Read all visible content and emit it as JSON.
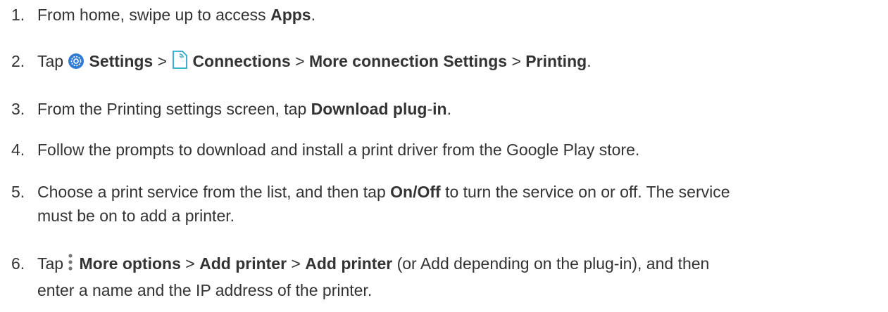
{
  "steps": [
    {
      "number": "1.",
      "parts": {
        "t1": "From home, swipe up to access ",
        "b1": "Apps",
        "t2": "."
      }
    },
    {
      "number": "2.",
      "parts": {
        "t1": "Tap ",
        "icon1": "settings-gear-icon",
        "b1": "Settings",
        "t2": " > ",
        "icon2": "connections-icon",
        "b2": "Connections",
        "t3": " > ",
        "b3": "More connection Settings",
        "t4": " > ",
        "b4": "Printing",
        "t5": "."
      }
    },
    {
      "number": "3.",
      "parts": {
        "t1": "From the Printing settings screen, tap ",
        "b1": "Download plug",
        "t2": "-",
        "b2": "in",
        "t3": "."
      }
    },
    {
      "number": "4.",
      "parts": {
        "t1": "Follow the prompts to download and install a print driver from the Google Play store."
      }
    },
    {
      "number": "5.",
      "parts": {
        "t1": "Choose a print service from the list, and then tap ",
        "b1": "On/Off",
        "t2": " to turn the service on or off. The service",
        "line2": "must be on to add a printer."
      }
    },
    {
      "number": "6.",
      "parts": {
        "t1": "Tap ",
        "icon1": "more-options-icon",
        "b1": "More options",
        "t2": " > ",
        "b2": "Add printer",
        "t3": " > ",
        "b3": "Add printer",
        "t4": " (or Add depending on the plug-in), and then",
        "line2": "enter a name and the IP address of the printer."
      }
    }
  ],
  "colors": {
    "text": "#333333",
    "settings_icon": "#2f7bd6",
    "connections_icon": "#29a8c9",
    "dots": "#777777"
  }
}
